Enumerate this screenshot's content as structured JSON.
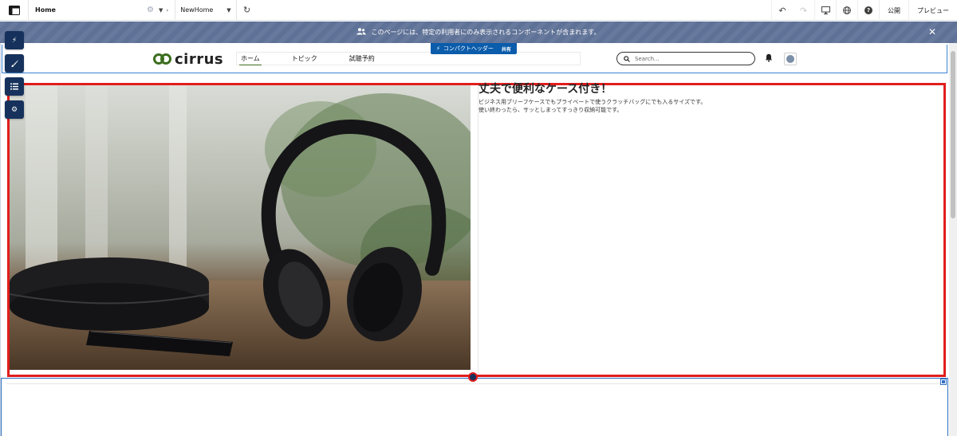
{
  "topbar": {
    "page_name": "Home",
    "nav_menu": "NewHome",
    "publish_label": "公開",
    "preview_label": "プレビュー"
  },
  "banner": {
    "text": "このページには、特定の利用者にのみ表示されるコンポーネントが含まれます。",
    "close_glyph": "✕"
  },
  "header_tag": {
    "label": "コンパクトヘッダー",
    "shared_label": "共有"
  },
  "site": {
    "logo_text": "cirrus",
    "nav_items": [
      "ホーム",
      "トピック",
      "試聴予約"
    ],
    "active_nav": 0,
    "search_placeholder": "Search..."
  },
  "content": {
    "title": "丈夫で便利なケース付き！",
    "body_lines": [
      "ビジネス用ブリーフケースでもプライベートで使うクラッチバッグにでも入るサイズです。",
      "使い終わったら、サッとしまってすっきり収納可能です。"
    ],
    "image_subject": "headphones-with-case-and-phone"
  },
  "colors": {
    "selection": "#e11d1d",
    "banner": "#5e7196",
    "side_tools": "#16325c",
    "header_tag": "#0b5cab",
    "logo_green": "#3c6e1f"
  },
  "icons": {
    "side_tools": [
      "lightning-icon",
      "brush-icon",
      "list-icon",
      "gear-icon"
    ],
    "toolbar_right": [
      "undo-icon",
      "redo-icon",
      "device-icon",
      "globe-icon",
      "help-icon"
    ]
  }
}
